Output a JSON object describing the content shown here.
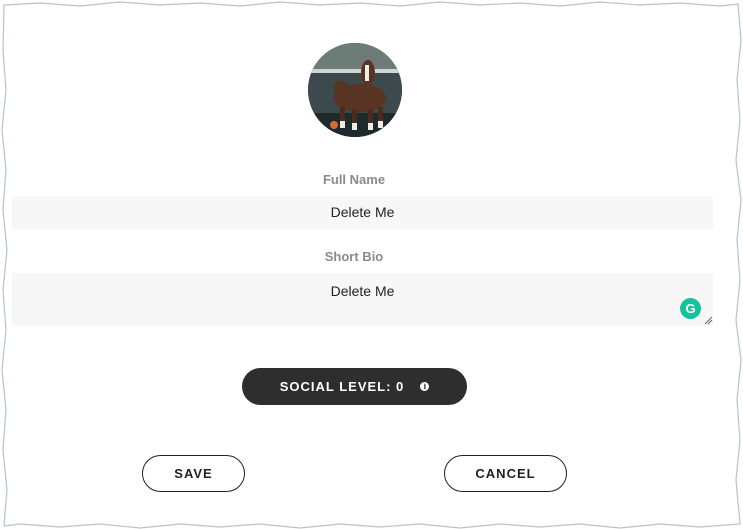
{
  "profile": {
    "avatar_icon": "horse-photo-avatar",
    "full_name_label": "Full Name",
    "full_name_value": "Delete Me",
    "short_bio_label": "Short Bio",
    "short_bio_value": "Delete Me"
  },
  "social": {
    "label": "SOCIAL LEVEL: 0",
    "info_icon": "info-icon",
    "info_glyph": "i"
  },
  "grammarly": {
    "icon": "grammarly-icon",
    "glyph": "G",
    "color": "#15c39a"
  },
  "actions": {
    "save_label": "SAVE",
    "cancel_label": "CANCEL"
  }
}
